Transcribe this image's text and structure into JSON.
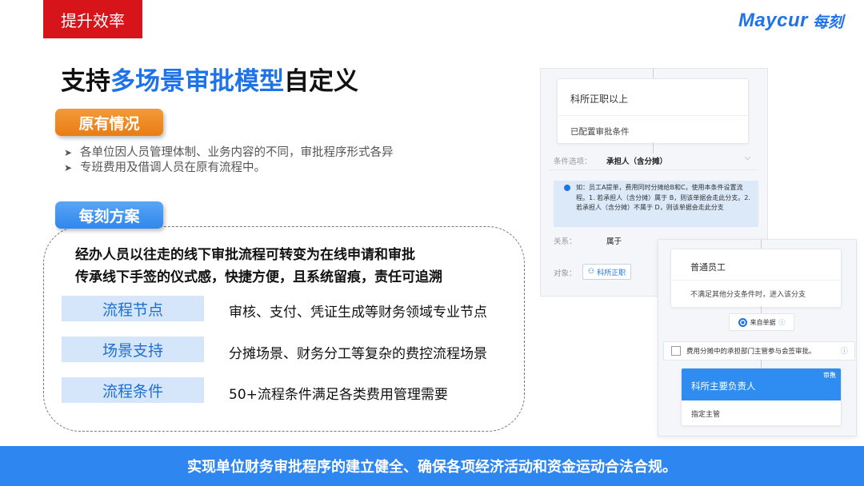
{
  "header": {
    "tag": "提升效率",
    "logo_en": "Maycur",
    "logo_cn": "每刻"
  },
  "title": {
    "part1": "支持",
    "highlight": "多场景审批模型",
    "part2": "自定义"
  },
  "original": {
    "pill": "原有情况",
    "bullets": [
      "各单位因人员管理体制、业务内容的不同，审批程序形式各异",
      "专班费用及借调人员在原有流程中。"
    ]
  },
  "solution": {
    "pill": "每刻方案",
    "statements": [
      "经办人员以往走的线下审批流程可转变为在线申请和审批",
      "传承线下手签的仪式感，快捷方便，且系统留痕，责任可追溯"
    ],
    "features": [
      {
        "label": "流程节点",
        "desc": "审核、支付、凭证生成等财务领域专业节点"
      },
      {
        "label": "场景支持",
        "desc": "分摊场景、财务分工等复杂的费控流程场景"
      },
      {
        "label": "流程条件",
        "desc": "50+流程条件满足各类费用管理需要"
      }
    ]
  },
  "banner": "实现单位财务审批程序的建立健全、确保各项经济活动和资金运动合法合规。",
  "shot1": {
    "card_title": "科所正职以上",
    "card_sub": "已配置审批条件",
    "cond_label": "条件选项：",
    "cond_value": "承担人（含分摊）",
    "tip": "如：员工A提单，费用同时分摊给B和C，使用本条件设置流程。1. 若承担人（含分摊）属于 B，则该单据会走此分支。2. 若承担人（含分摊）不属于 D，则该单据会走此分支",
    "rel_label": "关系：",
    "rel_value": "属于",
    "obj_label": "对象：",
    "obj_value": "科所正职"
  },
  "shot2": {
    "card_title": "普通员工",
    "card_sub": "不满足其他分支条件时，进入该分支",
    "radio_label": "来自单据",
    "checkbox_label": "费用分摊中的承担部门主管参与会签审批。",
    "node_badge": "审批",
    "node_title": "科所主要负责人",
    "node_sub": "指定主管"
  },
  "colors": {
    "brand_blue": "#1e73e8",
    "tag_red": "#d7141a",
    "orange": "#e97c13",
    "banner_blue": "#2e86f0",
    "label_bg": "#d6e6fa"
  },
  "icons": [
    "chevron-down-icon",
    "info-icon",
    "user-icon",
    "help-icon",
    "edit-icon",
    "radio-icon",
    "checkbox-icon"
  ]
}
